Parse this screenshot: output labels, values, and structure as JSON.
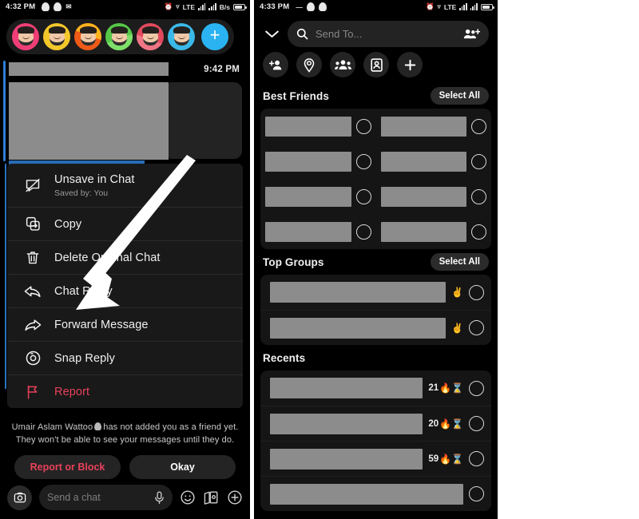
{
  "left_phone": {
    "status_bar": {
      "time": "4:32 PM",
      "network": "LTE",
      "battery_label": "B/s"
    },
    "reactions": [
      {
        "name": "heart-reaction",
        "style": "r-heart"
      },
      {
        "name": "cry-reaction",
        "style": "r-cry"
      },
      {
        "name": "fire-reaction",
        "style": "r-fire"
      },
      {
        "name": "thumbs-up-reaction",
        "style": "r-thumb"
      },
      {
        "name": "thumbs-down-reaction",
        "style": "r-down"
      },
      {
        "name": "neutral-reaction",
        "style": "r-blue"
      }
    ],
    "reaction_add_label": "+",
    "message": {
      "timestamp": "9:42 PM"
    },
    "context_menu": [
      {
        "label": "Unsave in Chat",
        "sublabel": "Saved by: You",
        "icon": "unsave-chat-icon",
        "danger": false
      },
      {
        "label": "Copy",
        "sublabel": "",
        "icon": "copy-icon",
        "danger": false
      },
      {
        "label": "Delete Original Chat",
        "sublabel": "",
        "icon": "trash-icon",
        "danger": false
      },
      {
        "label": "Chat Reply",
        "sublabel": "",
        "icon": "reply-arrow-icon",
        "danger": false
      },
      {
        "label": "Forward Message",
        "sublabel": "",
        "icon": "forward-arrow-icon",
        "danger": false
      },
      {
        "label": "Snap Reply",
        "sublabel": "",
        "icon": "camera-icon",
        "danger": false
      },
      {
        "label": "Report",
        "sublabel": "",
        "icon": "flag-icon",
        "danger": true
      }
    ],
    "friend_notice": {
      "line1_before": "Umair Aslam Wattoo",
      "line1_after": "has not added you as a friend yet.",
      "line2": "They won't be able to see your messages until they do.",
      "report_block_label": "Report or Block",
      "okay_label": "Okay"
    },
    "chat_input": {
      "placeholder": "Send a chat",
      "icons": [
        "camera-icon",
        "microphone-icon",
        "smiley-icon",
        "sticker-icon",
        "plus-icon"
      ]
    }
  },
  "right_phone": {
    "status_bar": {
      "time": "4:33 PM",
      "network": "LTE"
    },
    "search": {
      "placeholder": "Send To...",
      "icon": "search-icon",
      "trailing_icon": "add-friends-icon",
      "leading_icon": "chevron-down-icon"
    },
    "quick_actions": [
      {
        "name": "add-person-button",
        "icon": "person-plus-icon"
      },
      {
        "name": "location-button",
        "icon": "map-pin-icon"
      },
      {
        "name": "group-button",
        "icon": "group-icon"
      },
      {
        "name": "contact-card-button",
        "icon": "contact-card-icon"
      },
      {
        "name": "more-button",
        "icon": "plus-icon"
      }
    ],
    "sections": [
      {
        "title": "Best Friends",
        "select_all_label": "Select All",
        "layout": "grid",
        "rows": [
          {
            "cells": [
              "redacted",
              "redacted"
            ]
          },
          {
            "cells": [
              "redacted",
              "redacted"
            ]
          },
          {
            "cells": [
              "redacted",
              "redacted"
            ]
          },
          {
            "cells": [
              "redacted",
              "redacted"
            ]
          }
        ]
      },
      {
        "title": "Top Groups",
        "select_all_label": "Select All",
        "layout": "list",
        "rows": [
          {
            "meta": "",
            "emoji": "✌️"
          },
          {
            "meta": "",
            "emoji": "✌️"
          }
        ]
      },
      {
        "title": "Recents",
        "select_all_label": "",
        "layout": "list",
        "rows": [
          {
            "meta": "21",
            "emoji": "🔥⌛"
          },
          {
            "meta": "20",
            "emoji": "🔥⌛"
          },
          {
            "meta": "59",
            "emoji": "🔥⌛"
          }
        ]
      }
    ]
  },
  "annotation": {
    "name": "pointer-arrow",
    "color": "#ffffff",
    "points_to": "Forward Message"
  },
  "colors": {
    "background": "#000000",
    "canvas": "#ffffff",
    "menu_bg": "#191919",
    "accent_blue": "#2ab3f0",
    "saved_bar": "#2f7fd6",
    "danger_red": "#e8415a",
    "redaction_gray": "#8c8c8c"
  }
}
